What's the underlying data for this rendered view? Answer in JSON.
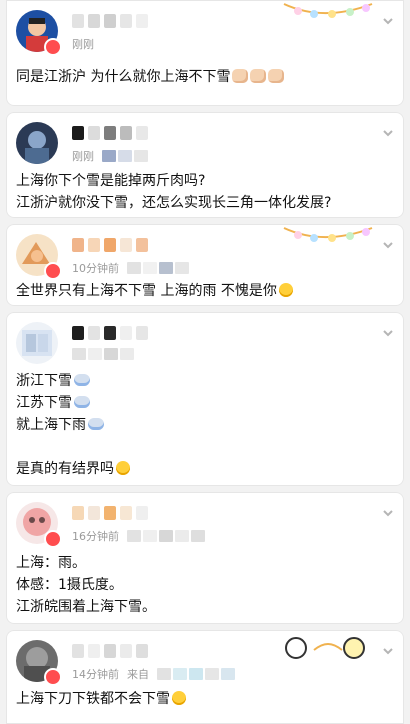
{
  "comments": [
    {
      "time": "刚刚",
      "text_lines": [
        "同是江浙沪 为什么就你上海不下雪"
      ],
      "emoji": [
        "fist",
        "fist",
        "fist"
      ]
    },
    {
      "time": "刚刚",
      "text_lines": [
        "上海你下个雪是能掉两斤肉吗?",
        "江浙沪就你没下雪，还怎么实现长三角一体化发展?"
      ]
    },
    {
      "time": "10分钟前",
      "text_lines": [
        "全世界只有上海不下雪 上海的雨 不愧是你"
      ],
      "emoji": [
        "smile"
      ]
    },
    {
      "time": "",
      "text_lines": [
        "浙江下雪",
        "江苏下雪",
        "就上海下雨",
        "",
        "是真的有结界吗"
      ],
      "emoji_per_line": [
        "cloud",
        "cloud",
        "cloud",
        "",
        "smile"
      ]
    },
    {
      "time": "16分钟前",
      "text_lines": [
        "上海：雨。",
        "体感：1摄氏度。",
        "江浙皖围着上海下雪。"
      ]
    },
    {
      "time": "14分钟前",
      "time_suffix": "来自",
      "text_lines": [
        "上海下刀下铁都不会下雪"
      ],
      "emoji": [
        "smile"
      ]
    }
  ],
  "icons": {
    "chevron": "chevron-down-icon",
    "avatar_badge": "badge-icon"
  },
  "colors": {
    "badge": "#ff4d4f",
    "muted": "#9a9a9a"
  }
}
